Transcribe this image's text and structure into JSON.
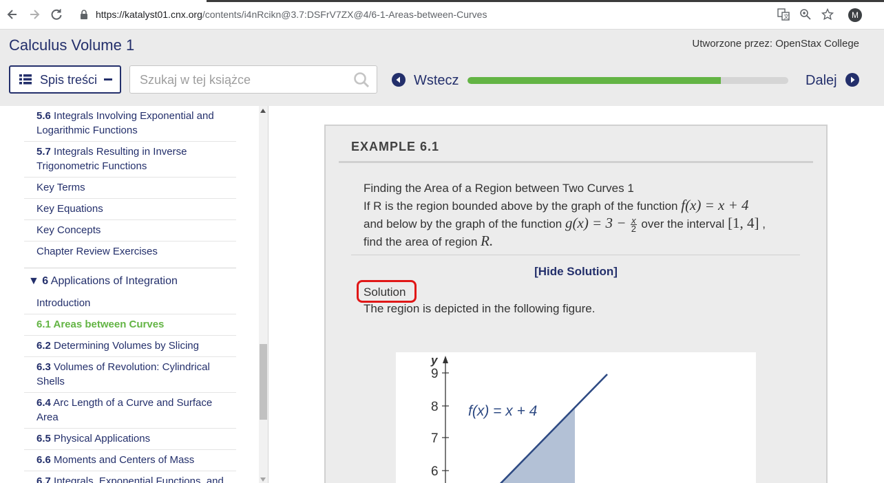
{
  "browser": {
    "url_host": "https://katalyst01.cnx.org",
    "url_path": "/contents/i4nRcikn@3.7:DSFrV7ZX@4/6-1-Areas-between-Curves",
    "avatar_letter": "M"
  },
  "header": {
    "book_title": "Calculus Volume 1",
    "author": "Utworzone przez: OpenStax College",
    "toc_button": "Spis treści",
    "search_placeholder": "Szukaj w tej książce",
    "prev_label": "Wstecz",
    "next_label": "Dalej"
  },
  "sidebar": {
    "items_top": [
      {
        "num": "5.6",
        "title": "Integrals Involving Exponential and Logarithmic Functions"
      },
      {
        "num": "5.7",
        "title": "Integrals Resulting in Inverse Trigonometric Functions"
      },
      {
        "num": "",
        "title": "Key Terms"
      },
      {
        "num": "",
        "title": "Key Equations"
      },
      {
        "num": "",
        "title": "Key Concepts"
      },
      {
        "num": "",
        "title": "Chapter Review Exercises"
      }
    ],
    "chapter": {
      "marker": "▼",
      "num": "6",
      "title": "Applications of Integration"
    },
    "items_chapter": [
      {
        "num": "",
        "title": "Introduction"
      },
      {
        "num": "6.1",
        "title": "Areas between Curves",
        "active": true
      },
      {
        "num": "6.2",
        "title": "Determining Volumes by Slicing"
      },
      {
        "num": "6.3",
        "title": "Volumes of Revolution: Cylindrical Shells"
      },
      {
        "num": "6.4",
        "title": "Arc Length of a Curve and Surface Area"
      },
      {
        "num": "6.5",
        "title": "Physical Applications"
      },
      {
        "num": "6.6",
        "title": "Moments and Centers of Mass"
      },
      {
        "num": "6.7",
        "title": "Integrals, Exponential Functions, and Logarithms"
      }
    ]
  },
  "content": {
    "example_label": "EXAMPLE 6.1",
    "problem_title": "Finding the Area of a Region between Two Curves 1",
    "problem_line1": "If R is the region bounded above by the graph of the function",
    "f_expr": "f(x) = x + 4",
    "problem_line2_a": "and below by the graph of the function",
    "g_expr": "g(x) = 3 −",
    "g_frac_num": "x",
    "g_frac_den": "2",
    "problem_line2_b": "over the interval",
    "interval": "[1, 4]",
    "problem_line3": "find the area of region",
    "region": "R.",
    "hide_solution": "[Hide Solution]",
    "solution_label": "Solution",
    "solution_text": "The region is depicted in the following figure.",
    "figure": {
      "y_axis_label": "y",
      "y_ticks": [
        "9",
        "8",
        "7",
        "6"
      ],
      "curve_label": "f(x) = x + 4"
    }
  },
  "progress": 0.79,
  "colors": {
    "primary": "#232f6b",
    "accent": "#63b444",
    "highlight": "#e01717"
  }
}
